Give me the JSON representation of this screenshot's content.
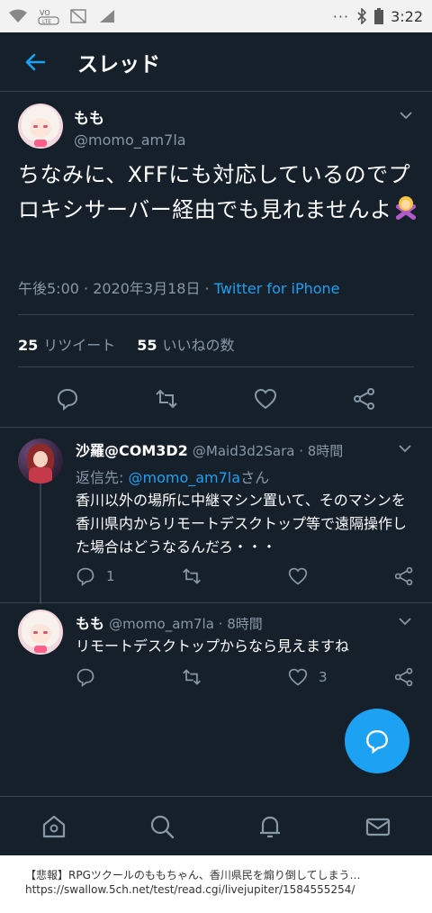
{
  "statusbar": {
    "time": "3:22",
    "dots": "···",
    "lte": "LTE"
  },
  "header": {
    "title": "スレッド"
  },
  "main_tweet": {
    "name": "もも",
    "handle": "@momo_am7la",
    "text": "ちなみに、XFFにも対応しているのでプロキシサーバー経由でも見れませんよ",
    "timestamp": "午後5:00 · 2020年3月18日 · ",
    "source": "Twitter for iPhone",
    "retweets_count": "25",
    "retweets_label": "リツイート",
    "likes_count": "55",
    "likes_label": "いいねの数"
  },
  "replies": [
    {
      "name": "沙羅@COM3D2",
      "handle": "@Maid3d2Sara · 8時間",
      "reply_to_prefix": "返信先: ",
      "reply_to_user": "@momo_am7la",
      "reply_to_suffix": "さん",
      "text": "香川以外の場所に中継マシン置いて、そのマシンを香川県内からリモートデスクトップ等で遠隔操作した場合はどうなるんだろ・・・",
      "reply_count": "1",
      "like_count": ""
    },
    {
      "name": "もも",
      "handle": "@momo_am7la · 8時間",
      "text": "リモートデスクトップからなら見えますね",
      "reply_count": "",
      "like_count": "3"
    }
  ],
  "caption": {
    "title": "【悲報】RPGツクールのももちゃん、香川県民を煽り倒してしまう…",
    "url": "https://swallow.5ch.net/test/read.cgi/livejupiter/1584555254/"
  },
  "colors": {
    "background": "#15202b",
    "accent": "#1da1f2",
    "muted": "#8899a6",
    "divider": "#38444d"
  },
  "icons": [
    "back-arrow-icon",
    "reply-icon",
    "retweet-icon",
    "like-icon",
    "share-icon",
    "compose-icon",
    "home-icon",
    "search-icon",
    "notifications-icon",
    "messages-icon"
  ]
}
